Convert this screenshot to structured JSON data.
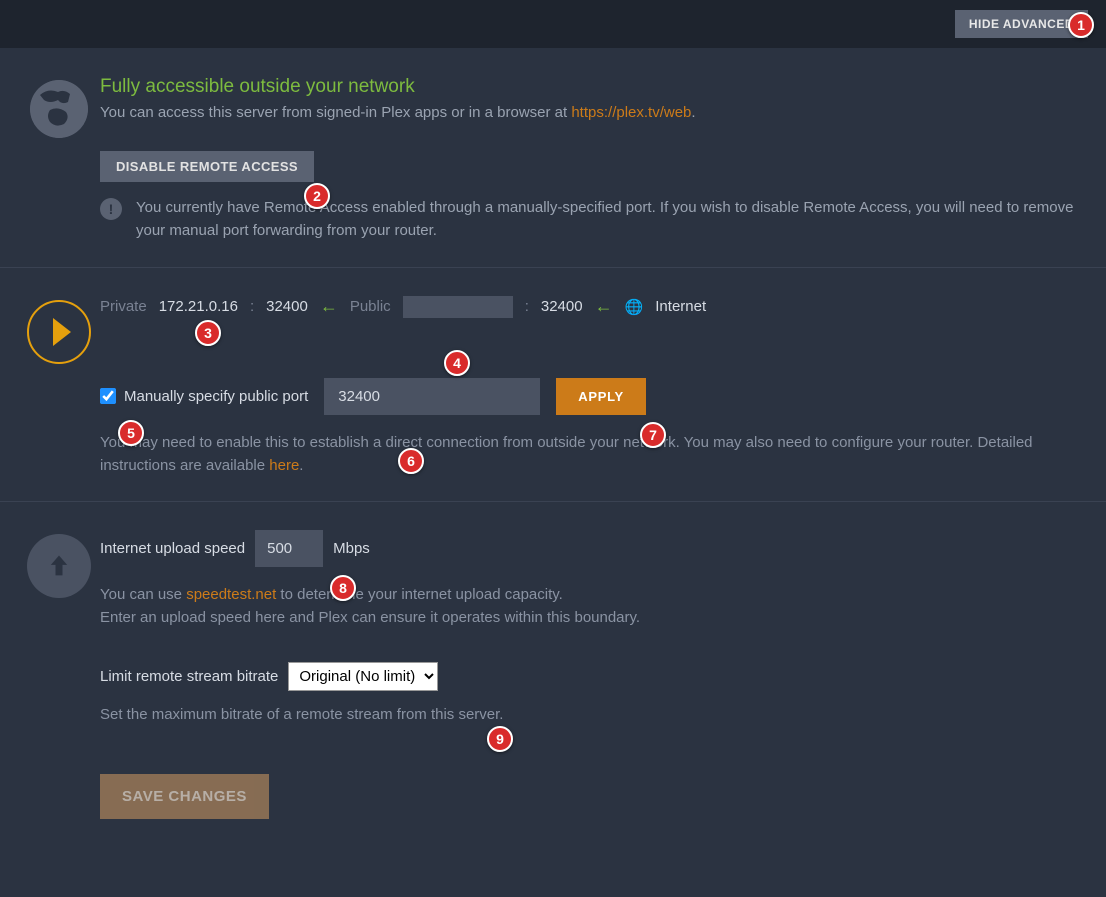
{
  "header": {
    "hide_advanced_label": "HIDE ADVANCED"
  },
  "status": {
    "title": "Fully accessible outside your network",
    "description_pre": "You can access this server from signed-in Plex apps or in a browser at ",
    "description_link": "https://plex.tv/web",
    "description_post": "."
  },
  "disable": {
    "button_label": "DISABLE REMOTE ACCESS",
    "warning_text": "You currently have Remote Access enabled through a manually-specified port. If you wish to disable Remote Access, you will need to remove your manual port forwarding from your router."
  },
  "network": {
    "private_label": "Private",
    "private_ip": "172.21.0.16",
    "private_port": "32400",
    "public_label": "Public",
    "public_port": "32400",
    "internet_label": "Internet"
  },
  "port": {
    "checkbox_label": "Manually specify public port",
    "checkbox_checked": true,
    "input_value": "32400",
    "apply_label": "APPLY",
    "help_pre": "You may need to enable this to establish a direct connection from outside your network. You may also need to configure your router. Detailed instructions are available ",
    "help_link": "here",
    "help_post": "."
  },
  "upload": {
    "label": "Internet upload speed",
    "value": "500",
    "unit": "Mbps",
    "help_pre": "You can use ",
    "help_link": "speedtest.net",
    "help_mid": " to determine your internet upload capacity.",
    "help_line2": "Enter an upload speed here and Plex can ensure it operates within this boundary."
  },
  "bitrate": {
    "label": "Limit remote stream bitrate",
    "selected": "Original (No limit)",
    "help": "Set the maximum bitrate of a remote stream from this server."
  },
  "save": {
    "label": "SAVE CHANGES"
  },
  "markers": {
    "m1": "1",
    "m2": "2",
    "m3": "3",
    "m4": "4",
    "m5": "5",
    "m6": "6",
    "m7": "7",
    "m8": "8",
    "m9": "9"
  }
}
